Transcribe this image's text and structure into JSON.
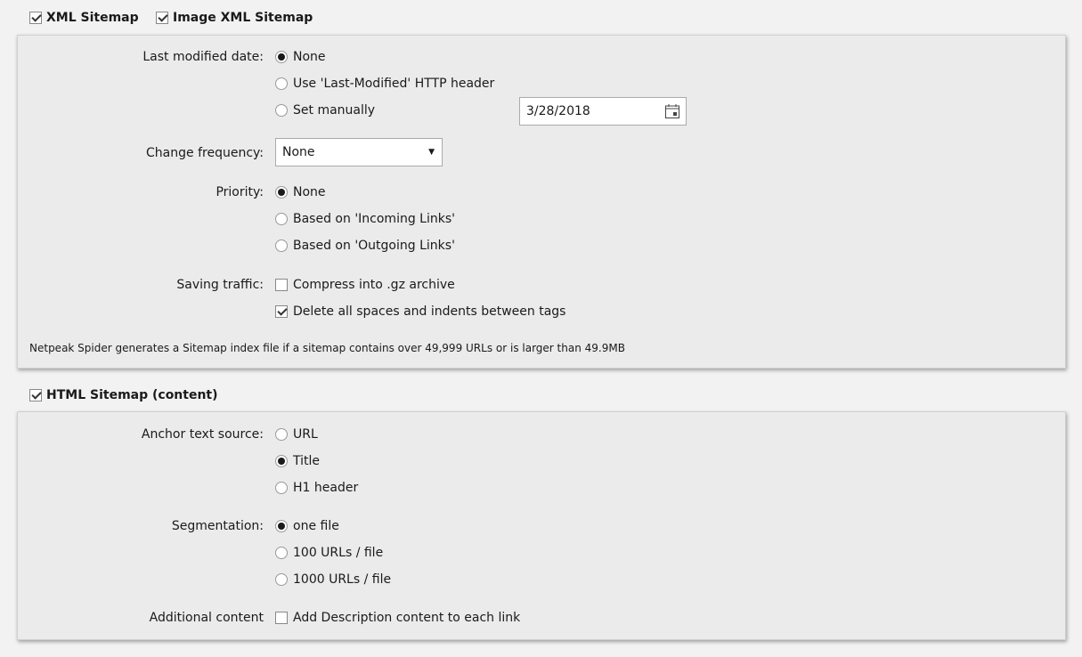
{
  "xml_sitemap": {
    "label": "XML Sitemap",
    "checked": true
  },
  "image_xml_sitemap": {
    "label": "Image XML Sitemap",
    "checked": true
  },
  "last_modified": {
    "label": "Last modified date:",
    "options": [
      "None",
      "Use 'Last-Modified' HTTP header",
      "Set manually"
    ],
    "selected": 0,
    "date": "3/28/2018"
  },
  "change_frequency": {
    "label": "Change frequency:",
    "value": "None"
  },
  "priority": {
    "label": "Priority:",
    "options": [
      "None",
      "Based on 'Incoming Links'",
      "Based on 'Outgoing Links'"
    ],
    "selected": 0
  },
  "saving_traffic": {
    "label": "Saving traffic:",
    "options": [
      {
        "label": "Compress into .gz archive",
        "checked": false
      },
      {
        "label": "Delete all spaces and indents between tags",
        "checked": true
      }
    ]
  },
  "note": "Netpeak Spider generates a Sitemap index file if a sitemap contains over 49,999 URLs or is larger than 49.9MB",
  "html_sitemap": {
    "label": "HTML Sitemap (content)",
    "checked": true
  },
  "anchor_text": {
    "label": "Anchor text source:",
    "options": [
      "URL",
      "Title",
      "H1 header"
    ],
    "selected": 1
  },
  "segmentation": {
    "label": "Segmentation:",
    "options": [
      "one file",
      "100 URLs / file",
      "1000 URLs / file"
    ],
    "selected": 0
  },
  "additional": {
    "label": "Additional content",
    "option": "Add Description content to each link",
    "checked": false
  }
}
